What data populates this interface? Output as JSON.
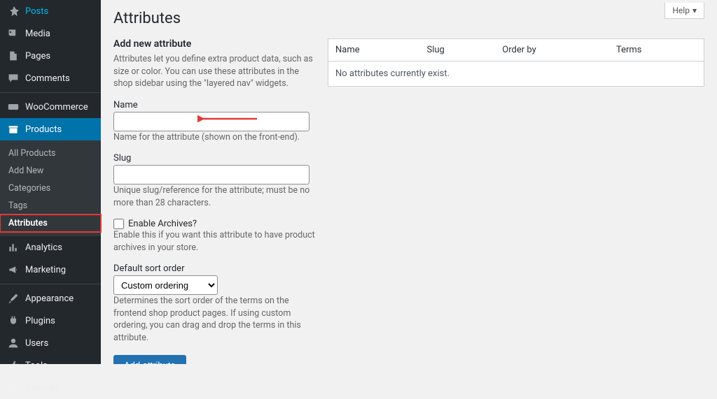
{
  "sidebar": {
    "items": [
      {
        "label": "Posts",
        "icon": "pin"
      },
      {
        "label": "Media",
        "icon": "media"
      },
      {
        "label": "Pages",
        "icon": "page"
      },
      {
        "label": "Comments",
        "icon": "comment"
      },
      {
        "label": "WooCommerce",
        "icon": "woo"
      },
      {
        "label": "Products",
        "icon": "archive"
      },
      {
        "label": "Analytics",
        "icon": "chart"
      },
      {
        "label": "Marketing",
        "icon": "megaphone"
      },
      {
        "label": "Appearance",
        "icon": "brush"
      },
      {
        "label": "Plugins",
        "icon": "plug"
      },
      {
        "label": "Users",
        "icon": "user"
      },
      {
        "label": "Tools",
        "icon": "wrench"
      },
      {
        "label": "Settings",
        "icon": "gear"
      }
    ],
    "submenu": [
      {
        "label": "All Products"
      },
      {
        "label": "Add New"
      },
      {
        "label": "Categories"
      },
      {
        "label": "Tags"
      },
      {
        "label": "Attributes"
      }
    ]
  },
  "help_label": "Help",
  "page_title": "Attributes",
  "form": {
    "heading": "Add new attribute",
    "intro": "Attributes let you define extra product data, such as size or color. You can use these attributes in the shop sidebar using the \"layered nav\" widgets.",
    "name_label": "Name",
    "name_value": "",
    "name_desc": "Name for the attribute (shown on the front-end).",
    "slug_label": "Slug",
    "slug_value": "",
    "slug_desc": "Unique slug/reference for the attribute; must be no more than 28 characters.",
    "archives_label": "Enable Archives?",
    "archives_desc": "Enable this if you want this attribute to have product archives in your store.",
    "sort_label": "Default sort order",
    "sort_value": "Custom ordering",
    "sort_desc": "Determines the sort order of the terms on the frontend shop product pages. If using custom ordering, you can drag and drop the terms in this attribute.",
    "submit": "Add attribute"
  },
  "table": {
    "headers": {
      "name": "Name",
      "slug": "Slug",
      "orderby": "Order by",
      "terms": "Terms"
    },
    "empty": "No attributes currently exist."
  }
}
